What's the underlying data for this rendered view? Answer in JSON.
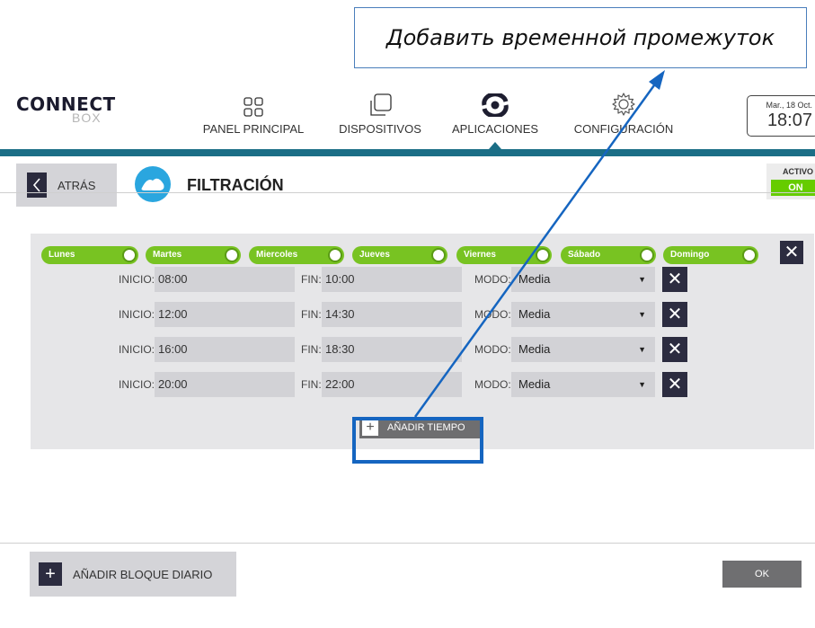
{
  "callout": {
    "text": "Добавить временной промежуток"
  },
  "header": {
    "logo_top": "CONNECT",
    "logo_bottom": "BOX",
    "nav": [
      {
        "label": "PANEL PRINCIPAL",
        "icon": "grid-icon"
      },
      {
        "label": "DISPOSITIVOS",
        "icon": "devices-icon"
      },
      {
        "label": "APLICACIONES",
        "icon": "applications-icon"
      },
      {
        "label": "CONFIGURACIÓN",
        "icon": "gear-icon"
      }
    ],
    "active_nav": "APLICACIONES",
    "date": "Mar., 18 Oct.",
    "time": "18:07"
  },
  "subheader": {
    "back_label": "ATRÁS",
    "title": "FILTRACIÓN",
    "status_label": "ACTIVO",
    "status_value": "ON"
  },
  "schedule": {
    "days": [
      "Lunes",
      "Martes",
      "Miercoles",
      "Jueves",
      "Viernes",
      "Sábado",
      "Domingo"
    ],
    "labels": {
      "start": "INICIO:",
      "end": "FIN:",
      "mode": "MODO:"
    },
    "rows": [
      {
        "start": "08:00",
        "end": "10:00",
        "mode": "Media"
      },
      {
        "start": "12:00",
        "end": "14:30",
        "mode": "Media"
      },
      {
        "start": "16:00",
        "end": "18:30",
        "mode": "Media"
      },
      {
        "start": "20:00",
        "end": "22:00",
        "mode": "Media"
      }
    ],
    "add_time_label": "AÑADIR TIEMPO"
  },
  "footer": {
    "add_block_label": "AÑADIR BLOQUE DIARIO",
    "ok_label": "OK"
  },
  "colors": {
    "accent_teal": "#1b6e86",
    "toggle_green": "#78c322",
    "highlight_blue": "#1565c0"
  }
}
